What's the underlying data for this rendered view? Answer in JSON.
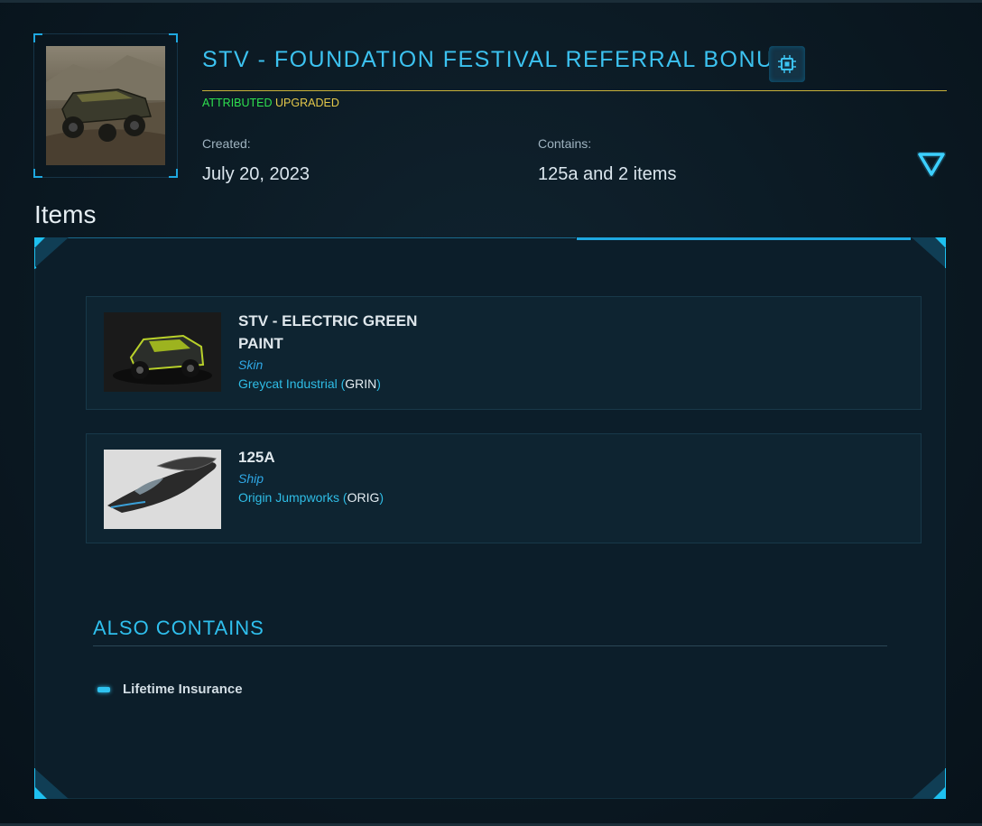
{
  "pledge": {
    "title": "STV - FOUNDATION FESTIVAL REFERRAL BONUS",
    "status_attributed": "ATTRIBUTED",
    "status_upgraded": "UPGRADED",
    "created_label": "Created:",
    "created_value": "July 20, 2023",
    "contains_label": "Contains:",
    "contains_value": "125a and 2 items",
    "chip_icon": "chip-icon",
    "expand_icon": "triangle-down-icon"
  },
  "items_section": {
    "title": "Items",
    "items": [
      {
        "name": "STV - ELECTRIC GREEN PAINT",
        "type": "Skin",
        "maker": "Greycat Industrial",
        "maker_code": "GRIN"
      },
      {
        "name": "125A",
        "type": "Ship",
        "maker": "Origin Jumpworks",
        "maker_code": "ORIG"
      }
    ]
  },
  "also_contains": {
    "title": "ALSO CONTAINS",
    "items": [
      "Lifetime Insurance"
    ]
  },
  "colors": {
    "accent": "#3cc2f0",
    "attributed": "#2fe04f",
    "upgraded": "#e5c94a",
    "rule_gold": "#c9b23a",
    "background": "#0b1a24"
  }
}
